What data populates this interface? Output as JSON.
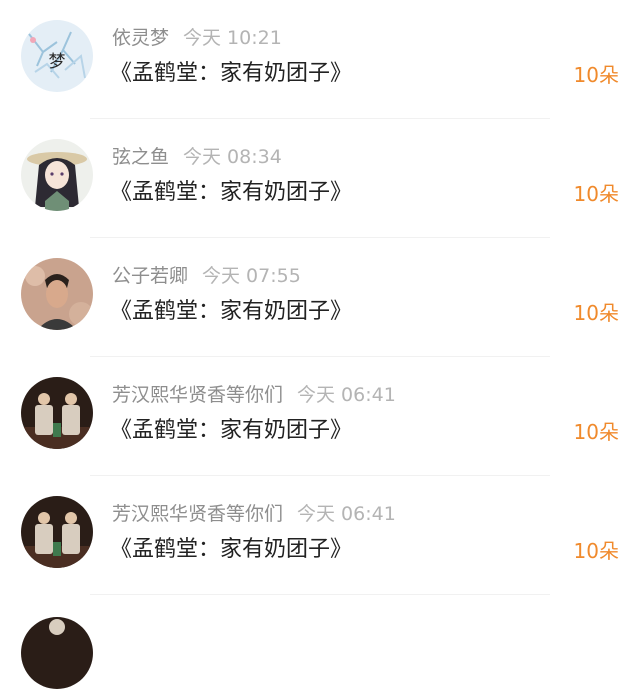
{
  "colors": {
    "accent": "#f08a2c",
    "name": "#8e8e8e",
    "time": "#b4b4b4",
    "title": "#222222"
  },
  "rows": [
    {
      "avatar": "dream-avatar",
      "name": "依灵梦",
      "time": "今天 10:21",
      "title": "《孟鹤堂：家有奶团子》",
      "count": "10朵",
      "avatar_text": "梦"
    },
    {
      "avatar": "anime-girl-avatar",
      "name": "弦之鱼",
      "time": "今天 08:34",
      "title": "《孟鹤堂：家有奶团子》",
      "count": "10朵"
    },
    {
      "avatar": "man-portrait-avatar",
      "name": "公子若卿",
      "time": "今天 07:55",
      "title": "《孟鹤堂：家有奶团子》",
      "count": "10朵"
    },
    {
      "avatar": "stage-duo-avatar",
      "name": "芳汉熙华贤香等你们",
      "time": "今天 06:41",
      "title": "《孟鹤堂：家有奶团子》",
      "count": "10朵"
    },
    {
      "avatar": "stage-duo-avatar",
      "name": "芳汉熙华贤香等你们",
      "time": "今天 06:41",
      "title": "《孟鹤堂：家有奶团子》",
      "count": "10朵"
    }
  ]
}
